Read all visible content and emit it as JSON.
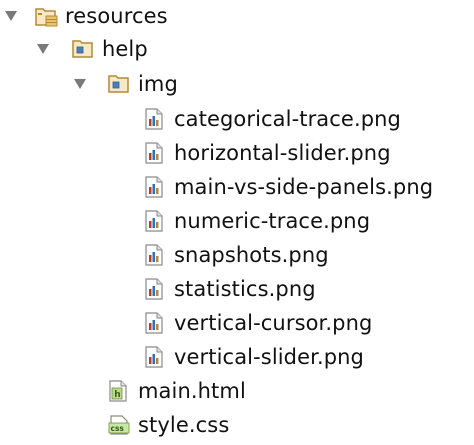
{
  "tree": {
    "resources": {
      "label": "resources",
      "icon": "resource-folder-icon",
      "expanded": true,
      "children": {
        "help": {
          "label": "help",
          "icon": "folder-icon",
          "expanded": true,
          "children": {
            "img": {
              "label": "img",
              "icon": "folder-icon",
              "expanded": true,
              "files": [
                {
                  "label": "categorical-trace.png",
                  "icon": "image-file-icon"
                },
                {
                  "label": "horizontal-slider.png",
                  "icon": "image-file-icon"
                },
                {
                  "label": "main-vs-side-panels.png",
                  "icon": "image-file-icon"
                },
                {
                  "label": "numeric-trace.png",
                  "icon": "image-file-icon"
                },
                {
                  "label": "snapshots.png",
                  "icon": "image-file-icon"
                },
                {
                  "label": "statistics.png",
                  "icon": "image-file-icon"
                },
                {
                  "label": "vertical-cursor.png",
                  "icon": "image-file-icon"
                },
                {
                  "label": "vertical-slider.png",
                  "icon": "image-file-icon"
                }
              ]
            },
            "files": [
              {
                "label": "main.html",
                "icon": "html-file-icon"
              },
              {
                "label": "style.css",
                "icon": "css-file-icon"
              }
            ]
          }
        }
      }
    }
  },
  "colors": {
    "arrow": "#7a7a7a",
    "folder_border": "#b08a3a",
    "folder_fill": "#e9c46a",
    "folder_blue_dot": "#4a7fbf",
    "html_icon_fill": "#b9d98b",
    "css_icon_fill": "#c9e7a7",
    "text": "#111111"
  }
}
